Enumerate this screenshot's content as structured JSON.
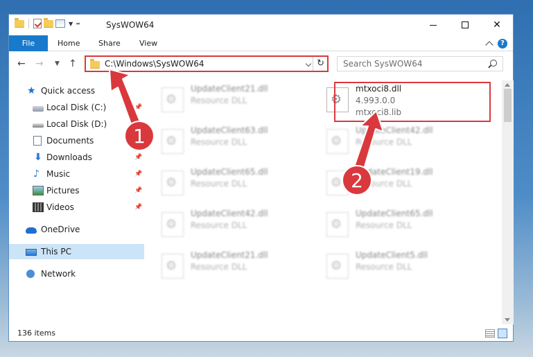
{
  "window": {
    "title": "SysWOW64"
  },
  "ribbon": {
    "tabs": [
      {
        "label": "File"
      },
      {
        "label": "Home"
      },
      {
        "label": "Share"
      },
      {
        "label": "View"
      }
    ],
    "help": "?"
  },
  "nav": {
    "address": "C:\\Windows\\SysWOW64",
    "search_placeholder": "Search SysWOW64"
  },
  "sidebar": {
    "items": [
      {
        "label": "Quick access",
        "icon": "star-icon",
        "pinned": false
      },
      {
        "label": "Local Disk (C:)",
        "icon": "drive-icon",
        "pinned": true
      },
      {
        "label": "Local Disk (D:)",
        "icon": "drive-icon",
        "pinned": false
      },
      {
        "label": "Documents",
        "icon": "documents-icon",
        "pinned": true
      },
      {
        "label": "Downloads",
        "icon": "downloads-icon",
        "pinned": true
      },
      {
        "label": "Music",
        "icon": "music-icon",
        "pinned": true
      },
      {
        "label": "Pictures",
        "icon": "pictures-icon",
        "pinned": true
      },
      {
        "label": "Videos",
        "icon": "videos-icon",
        "pinned": true
      },
      {
        "label": "OneDrive",
        "icon": "onedrive-icon",
        "pinned": false
      },
      {
        "label": "This PC",
        "icon": "this-pc-icon",
        "pinned": false,
        "selected": true
      },
      {
        "label": "Network",
        "icon": "network-icon",
        "pinned": false
      }
    ]
  },
  "files": {
    "left": [
      {
        "name": "UpdateClient21.dll",
        "type": "Resource DLL"
      },
      {
        "name": "UpdateClient63.dll",
        "type": "Resource DLL"
      },
      {
        "name": "UpdateClient65.dll",
        "type": "Resource DLL"
      },
      {
        "name": "UpdateClient42.dll",
        "type": "Resource DLL"
      },
      {
        "name": "UpdateClient21.dll",
        "type": "Resource DLL"
      }
    ],
    "right": [
      {
        "name": "mtxoci8.dll",
        "type": "4.993.0.0",
        "extra": "mtxoci8.lib",
        "highlighted": true
      },
      {
        "name": "UpdateClient42.dll",
        "type": "Resource DLL"
      },
      {
        "name": "UpdateClient19.dll",
        "type": "Resource DLL"
      },
      {
        "name": "UpdateClient65.dll",
        "type": "Resource DLL"
      },
      {
        "name": "UpdateClient5.dll",
        "type": "Resource DLL"
      }
    ]
  },
  "status": {
    "count": "136 items"
  },
  "annotations": [
    {
      "label": "1",
      "color": "#d9383d"
    },
    {
      "label": "2",
      "color": "#d9383d"
    }
  ],
  "colors": {
    "accent": "#1979ca",
    "highlight": "#d9383d",
    "selection": "#cce4f7"
  }
}
